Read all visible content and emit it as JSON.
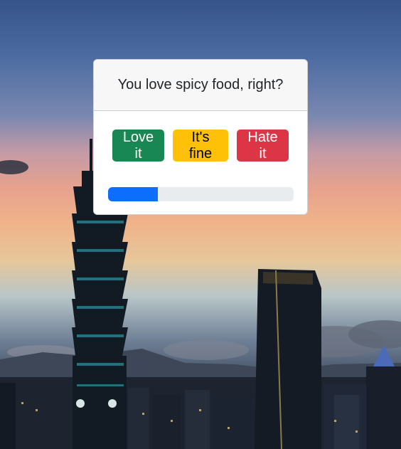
{
  "question": "You love spicy food, right?",
  "buttons": {
    "love": "Love it",
    "fine": "It's fine",
    "hate": "Hate it"
  },
  "progress": {
    "percent": 27
  },
  "colors": {
    "love": "#198754",
    "fine": "#ffc107",
    "hate": "#dc3545",
    "progress": "#0d6efd"
  }
}
